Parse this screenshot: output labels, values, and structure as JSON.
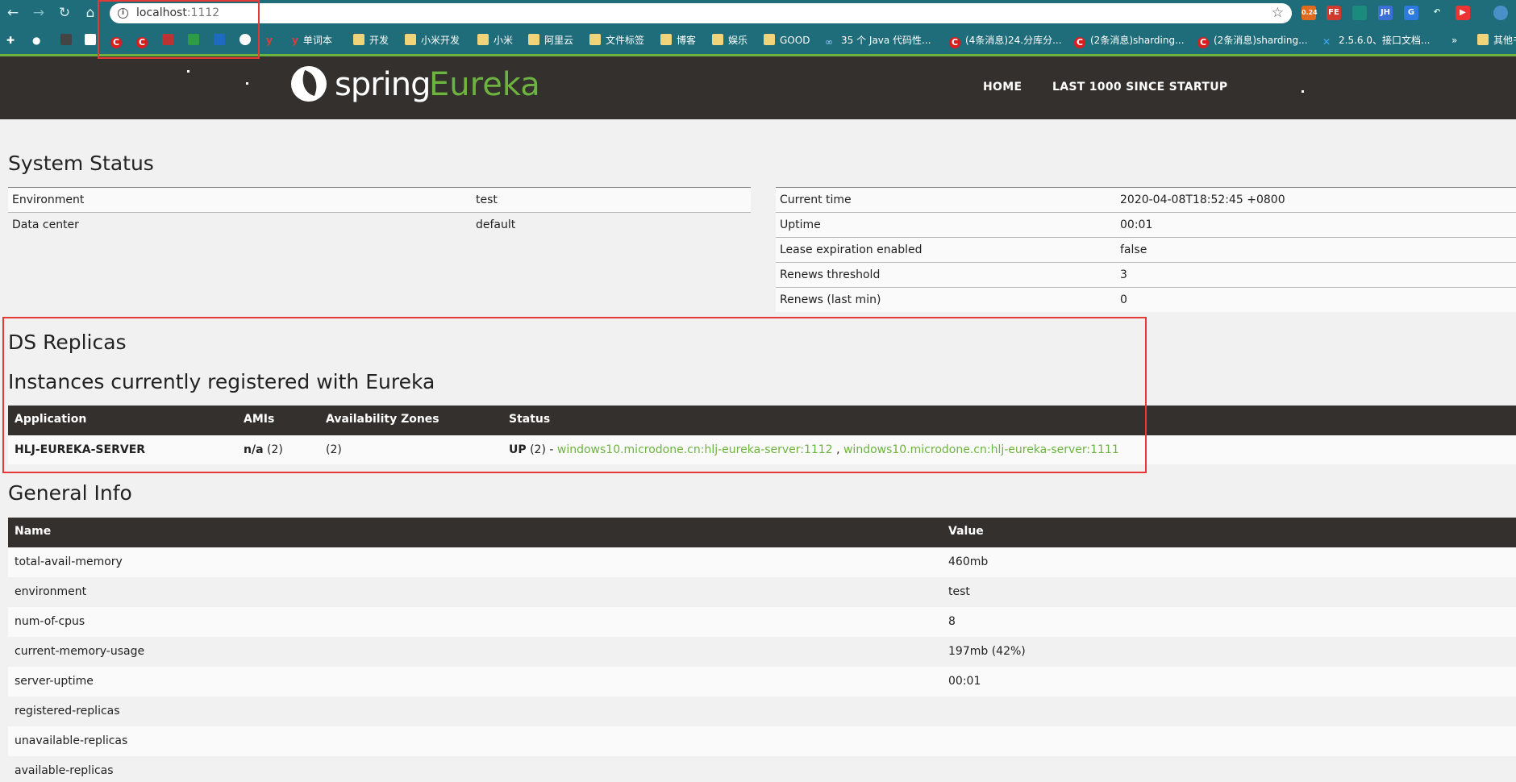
{
  "browser": {
    "url_host": "localhost",
    "url_port": ":1112",
    "ext_badge": "0.24",
    "bookmarks": [
      "单词本",
      "开发",
      "小米开发",
      "小米",
      "阿里云",
      "文件标签",
      "博客",
      "娱乐",
      "GOOD",
      "35 个 Java 代码性...",
      "(4条消息)24.分库分...",
      "(2条消息)sharding...",
      "(2条消息)sharding...",
      "2.5.6.0、接口文档...",
      "其他书"
    ]
  },
  "header": {
    "brand_spring": "spring",
    "brand_eureka": "Eureka",
    "nav_home": "HOME",
    "nav_last": "LAST 1000 SINCE STARTUP"
  },
  "system_status": {
    "title": "System Status",
    "left": [
      {
        "k": "Environment",
        "v": "test"
      },
      {
        "k": "Data center",
        "v": "default"
      }
    ],
    "right": [
      {
        "k": "Current time",
        "v": "2020-04-08T18:52:45 +0800"
      },
      {
        "k": "Uptime",
        "v": "00:01"
      },
      {
        "k": "Lease expiration enabled",
        "v": "false"
      },
      {
        "k": "Renews threshold",
        "v": "3"
      },
      {
        "k": "Renews (last min)",
        "v": "0"
      }
    ]
  },
  "replicas": {
    "title": "DS Replicas"
  },
  "instances": {
    "title": "Instances currently registered with Eureka",
    "headers": [
      "Application",
      "AMIs",
      "Availability Zones",
      "Status"
    ],
    "row": {
      "application": "HLJ-EUREKA-SERVER",
      "amis_bold": "n/a",
      "amis_count": " (2)",
      "zones": "(2)",
      "status_bold": "UP",
      "status_count": " (2) - ",
      "link1": "windows10.microdone.cn:hlj-eureka-server:1112",
      "sep": " , ",
      "link2": "windows10.microdone.cn:hlj-eureka-server:1111"
    }
  },
  "general_info": {
    "title": "General Info",
    "headers": [
      "Name",
      "Value"
    ],
    "rows": [
      {
        "k": "total-avail-memory",
        "v": "460mb"
      },
      {
        "k": "environment",
        "v": "test"
      },
      {
        "k": "num-of-cpus",
        "v": "8"
      },
      {
        "k": "current-memory-usage",
        "v": "197mb (42%)"
      },
      {
        "k": "server-uptime",
        "v": "00:01"
      },
      {
        "k": "registered-replicas",
        "v": ""
      },
      {
        "k": "unavailable-replicas",
        "v": ""
      },
      {
        "k": "available-replicas",
        "v": ""
      }
    ]
  }
}
